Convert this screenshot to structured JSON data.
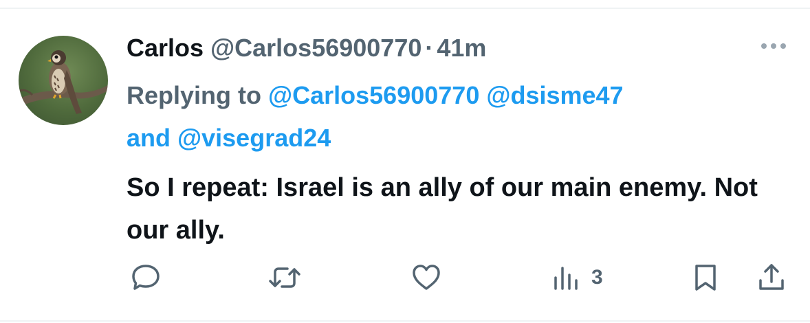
{
  "tweet": {
    "display_name": "Carlos",
    "handle": "@Carlos56900770",
    "separator": "·",
    "time": "41m",
    "replying_prefix": "Replying to",
    "mentions": [
      "@Carlos56900770",
      "@dsisme47",
      "@visegrad24"
    ],
    "mention_joiner": "and",
    "text": "So I repeat: Israel is an ally of our main enemy. Not our ally.",
    "avatar_icon": "falcon-on-branch"
  },
  "actions": {
    "reply_icon": "reply-icon",
    "retweet_icon": "retweet-icon",
    "like_icon": "heart-icon",
    "views_icon": "views-chart-icon",
    "views_count": "3",
    "bookmark_icon": "bookmark-icon",
    "share_icon": "share-icon",
    "more_icon": "more-dots-icon"
  },
  "colors": {
    "accent": "#1d9bf0",
    "secondary_text": "#536471",
    "primary_text": "#0f1419"
  }
}
